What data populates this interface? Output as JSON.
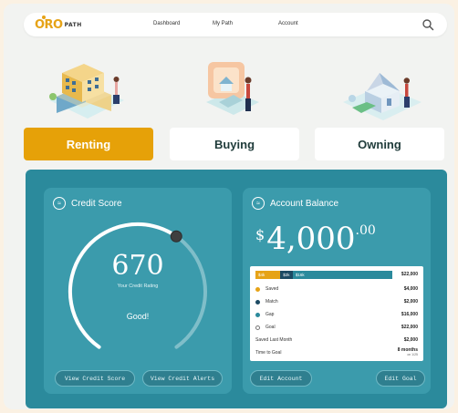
{
  "nav": {
    "logo_main": "ORO",
    "logo_sub": "PATH",
    "links": [
      "Dashboard",
      "My Path",
      "Account"
    ],
    "search_icon": "search-icon"
  },
  "categories": [
    {
      "label": "Renting",
      "active": true
    },
    {
      "label": "Buying",
      "active": false
    },
    {
      "label": "Owning",
      "active": false
    }
  ],
  "credit": {
    "title": "Credit Score",
    "score": "670",
    "subtitle": "Your Credit Rating",
    "rating": "Good!",
    "gauge_fraction": 0.62,
    "btn_view_score": "View Credit Score",
    "btn_view_alerts": "View Credit Alerts"
  },
  "balance": {
    "title": "Account Balance",
    "currency": "$",
    "amount": "4,000",
    "cents": ".00",
    "bar": [
      {
        "label": "$4k",
        "value": 4,
        "color": "#e6a317"
      },
      {
        "label": "$2k",
        "value": 2,
        "color": "#1c4a63"
      },
      {
        "label": "$16k",
        "value": 16,
        "color": "#2b8a9c"
      }
    ],
    "bar_total": "$22,000",
    "rows": [
      {
        "label": "Saved",
        "value": "$4,000",
        "color": "#e6a317"
      },
      {
        "label": "Match",
        "value": "$2,000",
        "color": "#1c4a63"
      },
      {
        "label": "Gap",
        "value": "$16,000",
        "color": "#2b8a9c"
      },
      {
        "label": "Goal",
        "value": "$22,000",
        "color": "#ffffff"
      }
    ],
    "saved_last_month_label": "Saved Last Month",
    "saved_last_month_value": "$2,000",
    "time_to_goal_label": "Time to Goal",
    "time_to_goal_value": "8 months",
    "time_to_goal_note": "on 1/25",
    "btn_edit_account": "Edit Account",
    "btn_edit_goal": "Edit Goal"
  },
  "colors": {
    "accent": "#e6a108",
    "teal": "#2b8a9c",
    "card": "#3b9bac",
    "navy": "#1c4a63"
  }
}
